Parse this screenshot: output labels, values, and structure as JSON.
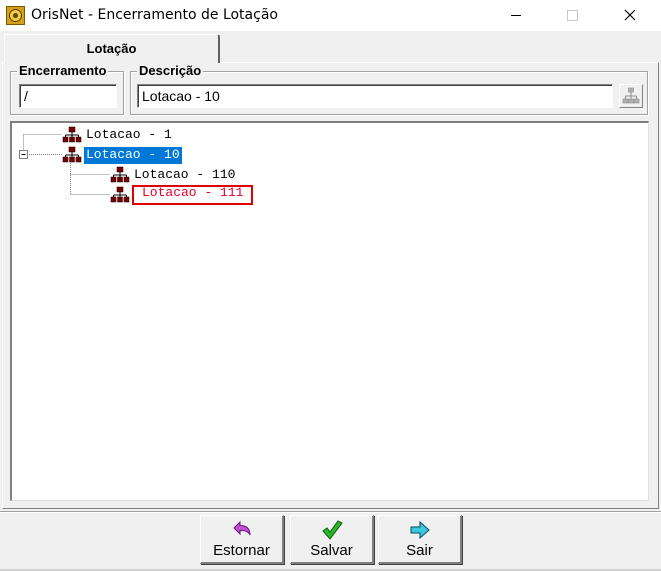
{
  "window": {
    "title": "OrisNet - Encerramento de Lotação",
    "icons": {
      "app": "orisnet-app-icon",
      "minimize": "minimize-icon",
      "maximize": "maximize-icon",
      "close": "close-icon"
    }
  },
  "tabs": [
    {
      "label": "Lotação",
      "active": true
    }
  ],
  "encerramento": {
    "label": "Encerramento",
    "value": "/"
  },
  "descricao": {
    "label": "Descrição",
    "value": "Lotacao - 10",
    "lookup_icon": "hierarchy-lookup-icon"
  },
  "tree": {
    "nodes": [
      {
        "label": "Lotacao - 1",
        "level": 0,
        "state": "normal"
      },
      {
        "label": "Lotacao - 10",
        "level": 0,
        "state": "selected",
        "expanded": true
      },
      {
        "label": "Lotacao - 110",
        "level": 1,
        "state": "normal"
      },
      {
        "label": "Lotacao - 111",
        "level": 1,
        "state": "highlighted"
      }
    ],
    "node_icon": "org-chart-icon",
    "highlight_color": "#e00000",
    "selection_color": "#0078d7"
  },
  "buttons": {
    "estornar": {
      "label": "Estornar",
      "icon": "undo-arrow-icon",
      "color": "#b040c0"
    },
    "salvar": {
      "label": "Salvar",
      "icon": "checkmark-icon",
      "color": "#1e9e1e"
    },
    "sair": {
      "label": "Sair",
      "icon": "exit-arrow-icon",
      "color": "#20b0c8"
    }
  }
}
